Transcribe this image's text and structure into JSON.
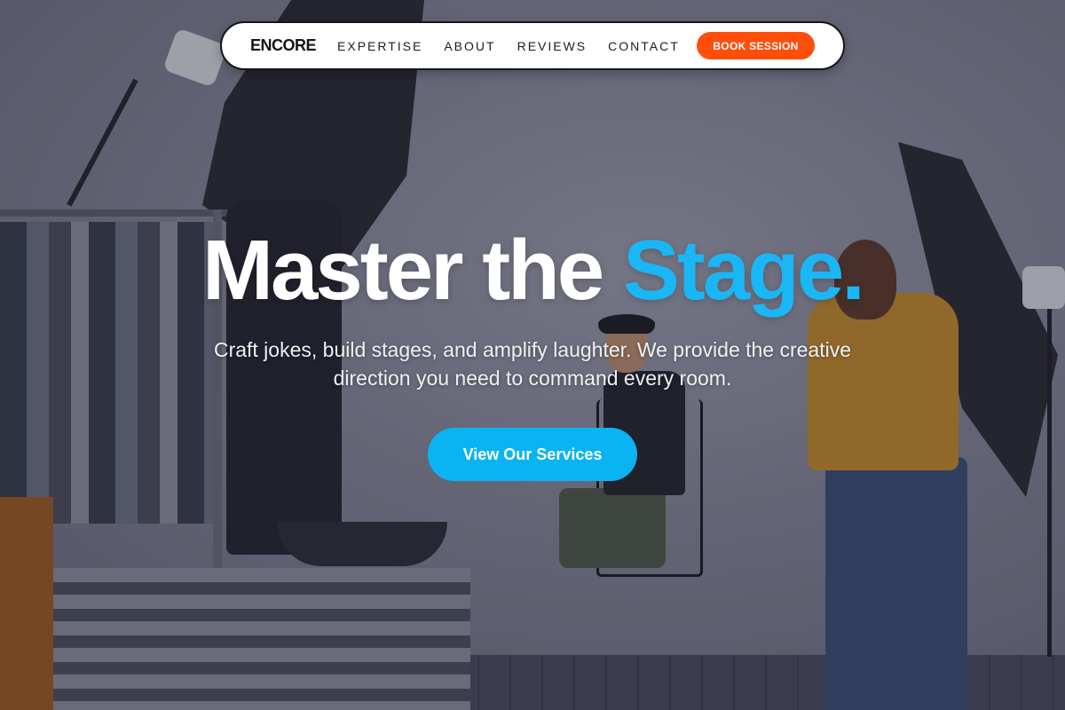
{
  "navbar": {
    "brand": "ENCORE",
    "links": [
      {
        "label": "EXPERTISE"
      },
      {
        "label": "ABOUT"
      },
      {
        "label": "REVIEWS"
      },
      {
        "label": "CONTACT"
      }
    ],
    "cta_label": "BOOK SESSION"
  },
  "hero": {
    "title_main": "Master the ",
    "title_accent": "Stage.",
    "subtitle": "Craft jokes, build stages, and amplify laughter. We provide the creative direction you need to command every room.",
    "button_label": "View Our Services"
  },
  "colors": {
    "accent": "#1ab6f5",
    "cta_orange": "#ff4d0a",
    "button_blue": "#0ab4f3"
  }
}
